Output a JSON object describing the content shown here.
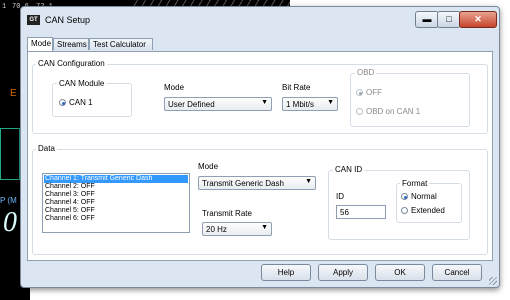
{
  "background_app": {
    "top_values": [
      "1",
      "70.6",
      "72.1"
    ],
    "side_label": "E",
    "big_number": "0",
    "prefix_text": "P (M"
  },
  "window": {
    "title": "CAN Setup",
    "icon_text": "GT",
    "controls": {
      "minimize": "▬",
      "maximize": "□",
      "close": "✕"
    }
  },
  "tabs": [
    {
      "label": "Mode",
      "active": true
    },
    {
      "label": "Streams",
      "active": false
    },
    {
      "label": "Test Calculator",
      "active": false
    }
  ],
  "can_configuration": {
    "group_label": "CAN Configuration",
    "can_module": {
      "label": "CAN Module",
      "option": "CAN 1",
      "selected": true
    },
    "mode": {
      "label": "Mode",
      "value": "User Defined"
    },
    "bit_rate": {
      "label": "Bit Rate",
      "value": "1 Mbit/s"
    },
    "obd": {
      "label": "OBD",
      "options": [
        {
          "label": "OFF",
          "selected": true
        },
        {
          "label": "OBD on CAN 1",
          "selected": false
        }
      ]
    }
  },
  "data": {
    "group_label": "Data",
    "channels": [
      "Channel 1: Transmit Generic Dash",
      "Channel 2: OFF",
      "Channel 3: OFF",
      "Channel 4: OFF",
      "Channel 5: OFF",
      "Channel 6: OFF"
    ],
    "selected_channel_index": 0,
    "mode": {
      "label": "Mode",
      "value": "Transmit Generic Dash"
    },
    "transmit_rate": {
      "label": "Transmit Rate",
      "value": "20 Hz"
    },
    "can_id": {
      "group_label": "CAN ID",
      "id_label": "ID",
      "id_value": "56",
      "format": {
        "label": "Format",
        "options": [
          {
            "label": "Normal",
            "selected": true
          },
          {
            "label": "Extended",
            "selected": false
          }
        ]
      }
    }
  },
  "buttons": {
    "help": "Help",
    "apply": "Apply",
    "ok": "OK",
    "cancel": "Cancel"
  }
}
